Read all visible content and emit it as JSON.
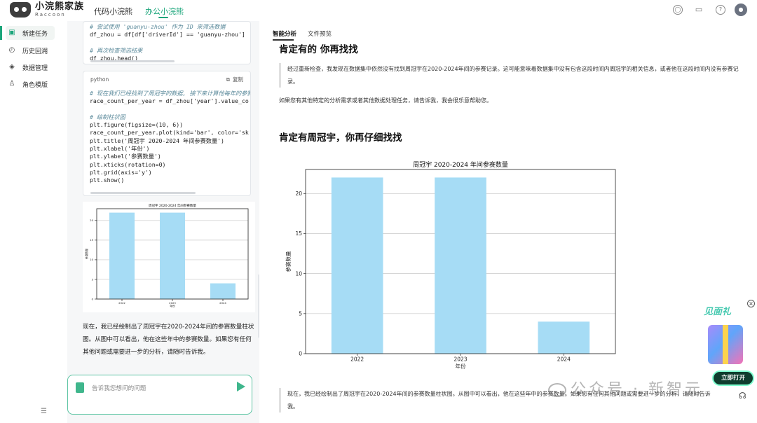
{
  "app": {
    "title": "小浣熊家族",
    "subtitle": "Raccoon"
  },
  "top_tabs": [
    {
      "label": "代码小浣熊",
      "active": false
    },
    {
      "label": "办公小浣熊",
      "active": true
    }
  ],
  "top_icons": [
    "globe-icon",
    "book-icon",
    "help-icon",
    "user-avatar"
  ],
  "sidebar": {
    "items": [
      {
        "label": "新建任务",
        "icon": "new-task-icon",
        "active": true
      },
      {
        "label": "历史回溯",
        "icon": "history-icon",
        "active": false
      },
      {
        "label": "数据管理",
        "icon": "data-icon",
        "active": false
      },
      {
        "label": "角色模版",
        "icon": "role-icon",
        "active": false
      }
    ]
  },
  "chat": {
    "code1_lines": [
      {
        "t": "# 尝试使用 'guanyu-zhou' 作为 ID 来筛选数据",
        "c": "cm"
      },
      {
        "t": "df_zhou = df[df['driverId'] == 'guanyu-zhou']",
        "c": ""
      },
      {
        "t": "",
        "c": ""
      },
      {
        "t": "# 再次检查筛选结果",
        "c": "cm"
      },
      {
        "t": "df_zhou.head()",
        "c": ""
      }
    ],
    "code2_lang": "python",
    "code2_copy": "复制",
    "code2_lines": [
      {
        "t": "# 现在我们已经找到了周冠宇的数据, 接下来计算他每年的参赛",
        "c": "cm"
      },
      {
        "t": "race_count_per_year = df_zhou['year'].value_co",
        "c": ""
      },
      {
        "t": "",
        "c": ""
      },
      {
        "t": "# 绘制柱状图",
        "c": "cm"
      },
      {
        "t": "plt.figure(figsize=(10, 6))",
        "c": ""
      },
      {
        "t": "race_count_per_year.plot(kind='bar', color='sk",
        "c": ""
      },
      {
        "t": "plt.title('周冠宇 2020-2024 年间参赛数量')",
        "c": ""
      },
      {
        "t": "plt.xlabel('年份')",
        "c": ""
      },
      {
        "t": "plt.ylabel('参赛数量')",
        "c": ""
      },
      {
        "t": "plt.xticks(rotation=0)",
        "c": ""
      },
      {
        "t": "plt.grid(axis='y')",
        "c": ""
      },
      {
        "t": "plt.show()",
        "c": ""
      }
    ],
    "message": "现在，我已经绘制出了周冠宇在2020-2024年间的参赛数量柱状图。从图中可以看出，他在这些年中的参赛数量。如果您有任何其他问题或需要进一步的分析，请随时告诉我。",
    "input_placeholder": "告诉我您想问的问题"
  },
  "panel": {
    "tabs": [
      {
        "label": "智能分析",
        "active": true
      },
      {
        "label": "文件预览",
        "active": false
      }
    ],
    "heading1": "肯定有的 你再找找",
    "quote1": "经过重新检查，我发现在数据集中依然没有找到周冠宇在2020-2024年间的参赛记录。这可能意味着数据集中没有包含这段时间内周冠宇的相关信息，或者他在这段时间内没有参赛记录。",
    "para1": "如果您有其他特定的分析需求或者其他数据处理任务，请告诉我，我会很乐意帮助您。",
    "heading2": "肯定有周冠宇，你再仔细找找",
    "quote2": "现在，我已经绘制出了周冠宇在2020-2024年间的参赛数量柱状图。从图中可以看出，他在这些年中的参赛数量。如果您有任何其他问题或需要进一步的分析，请随时告诉我。"
  },
  "promo": {
    "title": "见面礼",
    "button": "立即打开"
  },
  "watermark": "公众号 · 新智元",
  "colors": {
    "accent": "#1aa57a",
    "bar": "#a6dcf5",
    "input_border": "#5cc4a3"
  },
  "chart_data": {
    "type": "bar",
    "title": "周冠宇 2020-2024 年间参赛数量",
    "xlabel": "年份",
    "ylabel": "参赛数量",
    "categories": [
      "2022",
      "2023",
      "2024"
    ],
    "values": [
      22,
      22,
      4
    ],
    "ylim": [
      0,
      23
    ],
    "yticks": [
      0,
      5,
      10,
      15,
      20
    ],
    "grid": "y"
  }
}
